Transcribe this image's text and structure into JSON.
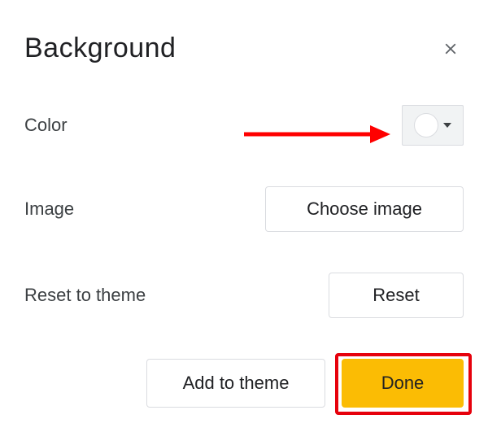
{
  "dialog": {
    "title": "Background",
    "rows": {
      "color": {
        "label": "Color",
        "swatch": "#ffffff"
      },
      "image": {
        "label": "Image",
        "button": "Choose image"
      },
      "reset": {
        "label": "Reset to theme",
        "button": "Reset"
      }
    },
    "footer": {
      "add_to_theme": "Add to theme",
      "done": "Done"
    }
  }
}
